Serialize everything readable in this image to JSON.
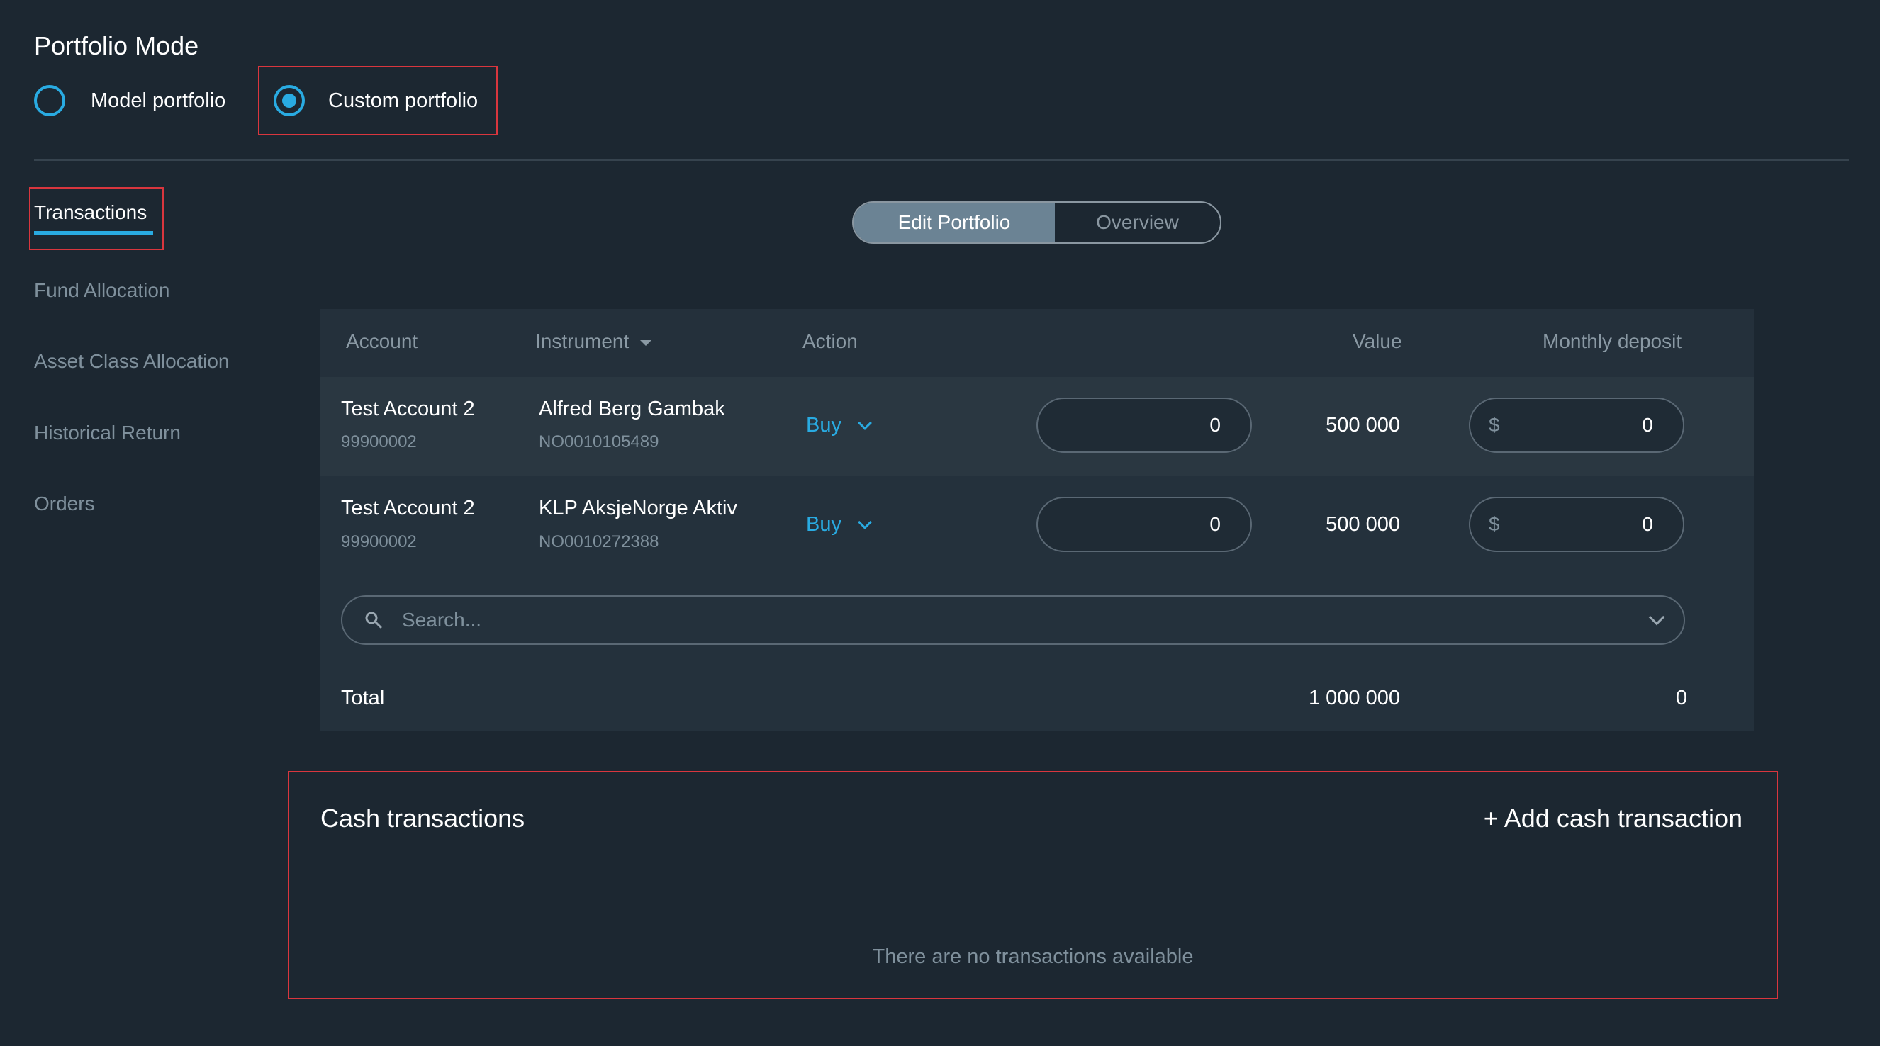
{
  "portfolio_mode": {
    "title": "Portfolio Mode",
    "options": [
      {
        "label": "Model portfolio",
        "checked": false
      },
      {
        "label": "Custom portfolio",
        "checked": true
      }
    ]
  },
  "sidebar": {
    "items": [
      {
        "label": "Transactions",
        "active": true
      },
      {
        "label": "Fund Allocation",
        "active": false
      },
      {
        "label": "Asset Class Allocation",
        "active": false
      },
      {
        "label": "Historical Return",
        "active": false
      },
      {
        "label": "Orders",
        "active": false
      }
    ]
  },
  "view_toggle": {
    "options": [
      "Edit Portfolio",
      "Overview"
    ],
    "selected": "Edit Portfolio"
  },
  "table": {
    "headers": {
      "account": "Account",
      "instrument": "Instrument",
      "action": "Action",
      "value": "Value",
      "monthly_deposit": "Monthly deposit"
    },
    "rows": [
      {
        "account_name": "Test Account 2",
        "account_number": "99900002",
        "instrument_name": "Alfred Berg Gambak",
        "isin": "NO0010105489",
        "action": "Buy",
        "amount": "0",
        "value": "500 000",
        "currency": "$",
        "monthly_deposit": "0"
      },
      {
        "account_name": "Test Account 2",
        "account_number": "99900002",
        "instrument_name": "KLP AksjeNorge Aktiv",
        "isin": "NO0010272388",
        "action": "Buy",
        "amount": "0",
        "value": "500 000",
        "currency": "$",
        "monthly_deposit": "0"
      }
    ],
    "search_placeholder": "Search...",
    "total": {
      "label": "Total",
      "value": "1 000 000",
      "monthly_deposit": "0"
    }
  },
  "cash_transactions": {
    "title": "Cash transactions",
    "add_label": "+ Add cash transaction",
    "empty_message": "There are no transactions available"
  },
  "colors": {
    "background": "#1c2731",
    "accent": "#29abe2",
    "highlight_border": "#d9363e",
    "muted_text": "#7f909c"
  }
}
